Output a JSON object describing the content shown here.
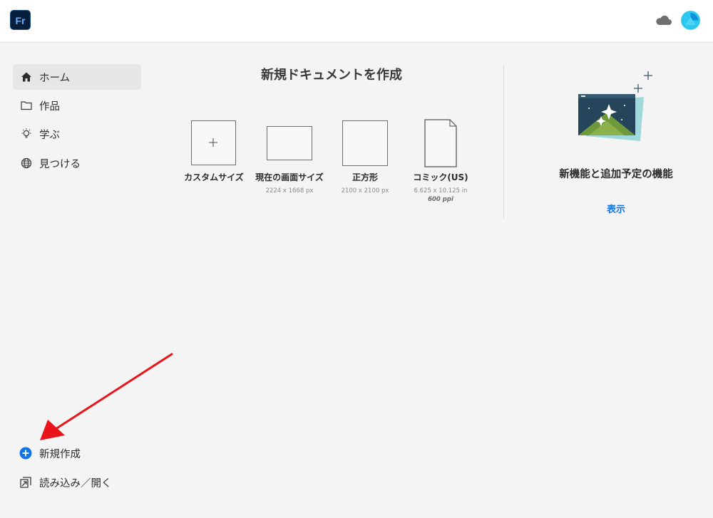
{
  "app": {
    "logo_text": "Fr"
  },
  "sidebar": {
    "items": [
      {
        "label": "ホーム",
        "icon": "home-icon",
        "active": true
      },
      {
        "label": "作品",
        "icon": "folder-icon",
        "active": false
      },
      {
        "label": "学ぶ",
        "icon": "lightbulb-icon",
        "active": false
      },
      {
        "label": "見つける",
        "icon": "globe-icon",
        "active": false
      }
    ],
    "bottom": [
      {
        "label": "新規作成",
        "icon": "plus-circle-icon"
      },
      {
        "label": "読み込み／開く",
        "icon": "import-icon"
      }
    ]
  },
  "main": {
    "title": "新規ドキュメントを作成",
    "presets": [
      {
        "label": "カスタムサイズ",
        "sub": "",
        "sub2": ""
      },
      {
        "label": "現在の画面サイズ",
        "sub": "2224 x 1668 px",
        "sub2": ""
      },
      {
        "label": "正方形",
        "sub": "2100 x 2100 px",
        "sub2": ""
      },
      {
        "label": "コミック(US)",
        "sub": "6.625 x 10.125 in",
        "sub2": "600 ppi"
      }
    ]
  },
  "whats_new": {
    "title": "新機能と追加予定の機能",
    "link": "表示"
  },
  "colors": {
    "accent": "#1473e6",
    "annotation_arrow": "#e8141a",
    "logo_bg": "#061e3c"
  }
}
